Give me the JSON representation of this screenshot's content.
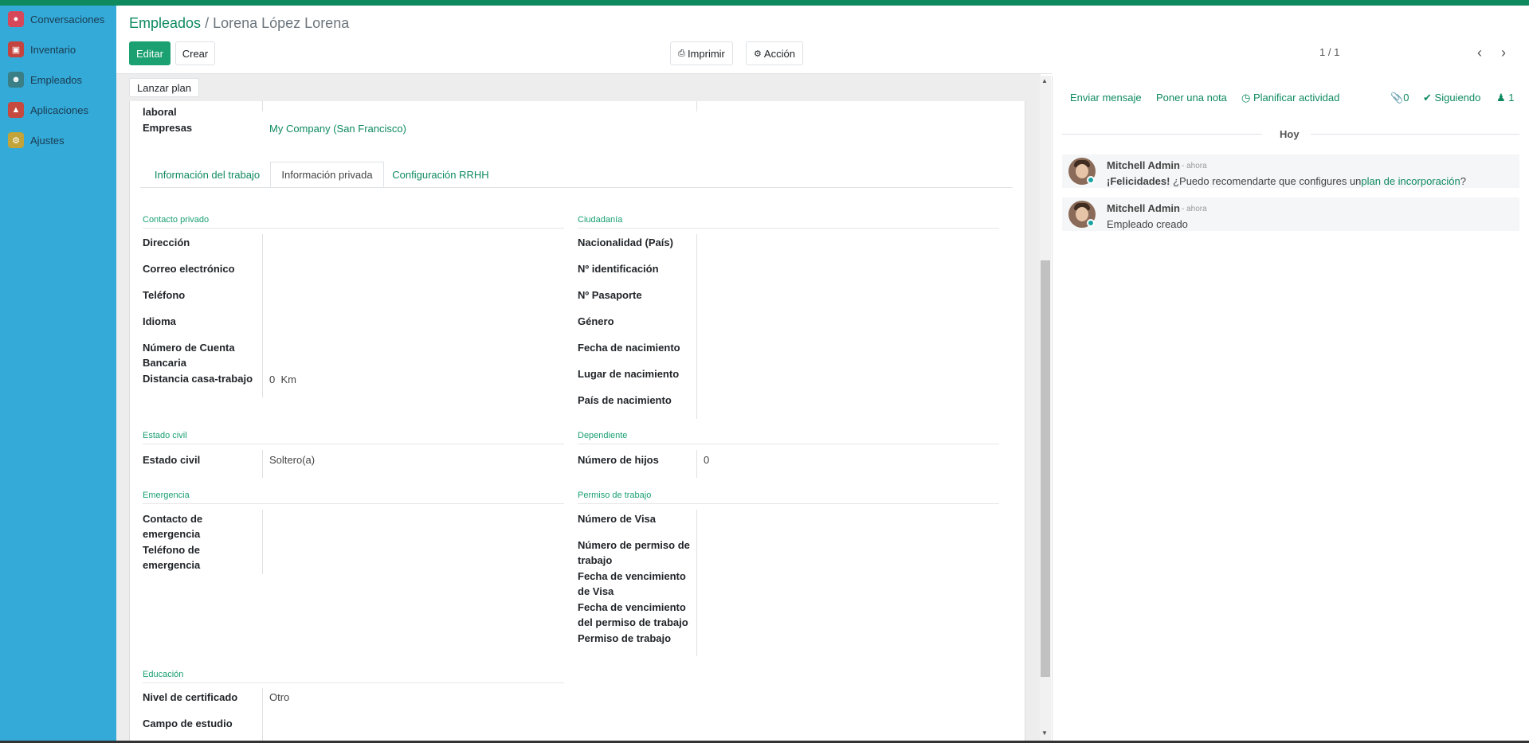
{
  "colors": {
    "topbar": "#0f8a5f",
    "sidebar": "#33aad8",
    "accent": "#1aa071",
    "link": "#0e8a5f"
  },
  "sidebar": {
    "items": [
      {
        "label": "Conversaciones",
        "icon": "chat-bubble-icon",
        "color": "#d6475a"
      },
      {
        "label": "Inventario",
        "icon": "box-icon",
        "color": "#c4453f"
      },
      {
        "label": "Empleados",
        "icon": "people-icon",
        "color": "#3a7f86"
      },
      {
        "label": "Aplicaciones",
        "icon": "apps-icon",
        "color": "#c64a3f"
      },
      {
        "label": "Ajustes",
        "icon": "gear-icon",
        "color": "#c2a43a"
      }
    ]
  },
  "breadcrumb": {
    "parent": "Empleados",
    "separator": " / ",
    "current": "Lorena López Lorena"
  },
  "toolbar": {
    "edit": "Editar",
    "create": "Crear",
    "print": "Imprimir",
    "action": "Acción",
    "launch_plan": "Lanzar plan"
  },
  "pager": {
    "text": "1 / 1"
  },
  "form": {
    "top_fields": {
      "partial_label": "laboral",
      "company_label": "Empresas",
      "company_value": "My Company (San Francisco)"
    },
    "tabs": [
      "Información del trabajo",
      "Información privada",
      "Configuración RRHH"
    ],
    "private_contact": {
      "title": "Contacto privado",
      "address": "Dirección",
      "email": "Correo electrónico",
      "phone": "Teléfono",
      "language": "Idioma",
      "bank_line1": "Número de Cuenta",
      "bank_line2": "Bancaria",
      "distance": "Distancia casa-trabajo",
      "distance_value": "0",
      "distance_unit": "Km"
    },
    "citizenship": {
      "title": "Ciudadanía",
      "nationality": "Nacionalidad (País)",
      "id_number": "Nº identificación",
      "passport": "Nº Pasaporte",
      "gender": "Género",
      "birthdate": "Fecha de nacimiento",
      "birthplace": "Lugar de nacimiento",
      "birth_country": "País de nacimiento"
    },
    "marital": {
      "title": "Estado civil",
      "label": "Estado civil",
      "value": "Soltero(a)"
    },
    "dependents": {
      "title": "Dependiente",
      "label": "Número de hijos",
      "value": "0"
    },
    "emergency": {
      "title": "Emergencia",
      "contact_line1": "Contacto de",
      "contact_line2": "emergencia",
      "phone_line1": "Teléfono de",
      "phone_line2": "emergencia"
    },
    "work_permit": {
      "title": "Permiso de trabajo",
      "visa_number": "Número de Visa",
      "permit_number_line1": "Número de permiso de",
      "permit_number_line2": "trabajo",
      "visa_expire_line1": "Fecha de vencimiento",
      "visa_expire_line2": "de Visa",
      "permit_expire_line1": "Fecha de vencimiento",
      "permit_expire_line2": "del permiso de trabajo",
      "permit": "Permiso de trabajo"
    },
    "education": {
      "title": "Educación",
      "level_label": "Nivel de certificado",
      "level_value": "Otro",
      "field_label": "Campo de estudio"
    }
  },
  "chatter": {
    "send_message": "Enviar mensaje",
    "log_note": "Poner una nota",
    "schedule_activity": "Planificar actividad",
    "attachments_count": "0",
    "following": "Siguiendo",
    "followers_count": "1",
    "date_separator": "Hoy",
    "messages": [
      {
        "author": "Mitchell Admin",
        "time": "- ahora",
        "bold_prefix": "¡Felicidades!",
        "body": " ¿Puedo recomendarte que configures un",
        "link": "plan de incorporación",
        "suffix": "?"
      },
      {
        "author": "Mitchell Admin",
        "time": "- ahora",
        "body": "Empleado creado"
      }
    ]
  }
}
